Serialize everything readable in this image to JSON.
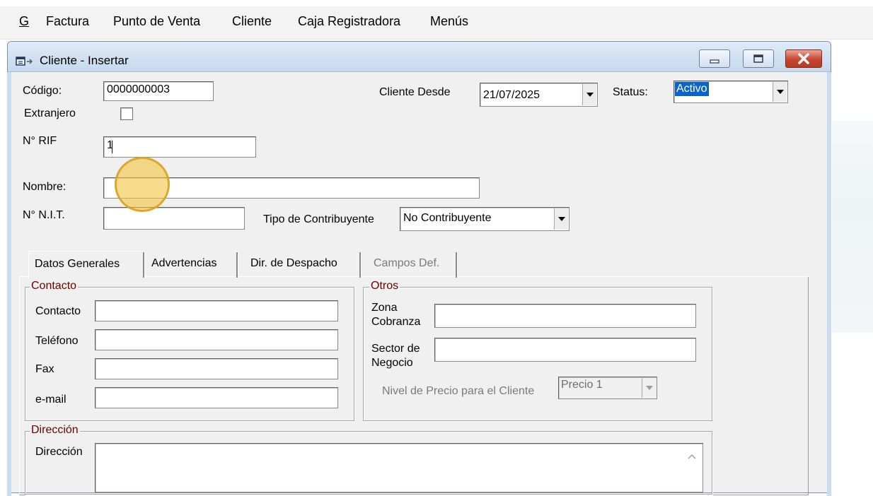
{
  "menu": {
    "items": [
      {
        "label": "G"
      },
      {
        "label": "Factura"
      },
      {
        "label": "Punto de Venta"
      },
      {
        "label": "Cliente"
      },
      {
        "label": "Caja Registradora"
      },
      {
        "label": "Menús"
      }
    ]
  },
  "window": {
    "title": "Cliente - Insertar",
    "icons": {
      "app": "window-app-icon",
      "minimize": "minimize-icon",
      "maximize": "maximize-icon",
      "close": "close-icon"
    }
  },
  "header": {
    "codigo_label": "Código:",
    "codigo_value": "0000000003",
    "extranjero_label": "Extranjero",
    "extranjero_checked": false,
    "rif_label": "N° RIF",
    "rif_value": "1",
    "nombre_label": "Nombre:",
    "nombre_value": "",
    "nit_label": "N° N.I.T.",
    "nit_value": "",
    "tipo_label": "Tipo de Contribuyente",
    "tipo_value": "No Contribuyente",
    "cliente_desde_label": "Cliente Desde",
    "cliente_desde_value": "21/07/2025",
    "status_label": "Status:",
    "status_value": "Activo"
  },
  "tabs": [
    {
      "label": "Datos Generales",
      "active": true
    },
    {
      "label": "Advertencias",
      "active": false
    },
    {
      "label": "Dir. de Despacho",
      "active": false
    },
    {
      "label": "Campos Def.",
      "active": false,
      "disabled": true
    }
  ],
  "contacto": {
    "title": "Contacto",
    "contacto_label": "Contacto",
    "telefono_label": "Teléfono",
    "fax_label": "Fax",
    "email_label": "e-mail"
  },
  "otros": {
    "title": "Otros",
    "zona_label_1": "Zona",
    "zona_label_2": "Cobranza",
    "sector_label_1": "Sector de",
    "sector_label_2": "Negocio",
    "nivel_label": "Nivel de Precio para el Cliente",
    "nivel_value": "Precio 1"
  },
  "direccion": {
    "title": "Dirección",
    "label": "Dirección",
    "value": ""
  },
  "colors": {
    "group_title": "#6b0000",
    "selection": "#0a64c8",
    "cursor_highlight": "#f4c440"
  }
}
